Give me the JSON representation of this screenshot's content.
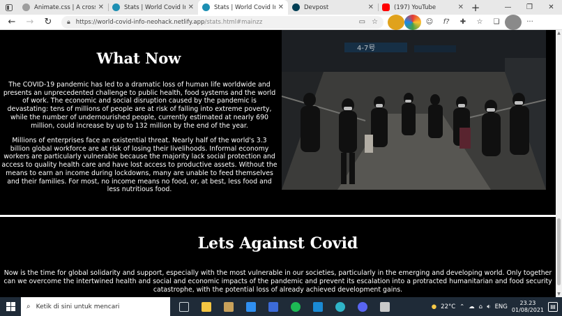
{
  "browser": {
    "tabs": [
      {
        "title": "Animate.css | A cross-brow",
        "fav_color": "#9e9e9e",
        "active": false
      },
      {
        "title": "Stats | World Covid Info",
        "fav_color": "#1d8fb3",
        "active": false
      },
      {
        "title": "Stats | World Covid Info",
        "fav_color": "#1d8fb3",
        "active": true
      },
      {
        "title": "Devpost",
        "fav_color": "#003e54",
        "active": false
      },
      {
        "title": "(197) YouTube",
        "fav_color": "#ff0000",
        "active": false
      }
    ],
    "url_host": "https://world-covid-info-neohack.netlify.app",
    "url_path": "/stats.html#mainzz"
  },
  "page": {
    "section1": {
      "heading": "What Now",
      "paragraph1": "The COVID-19 pandemic has led to a dramatic loss of human life worldwide and presents an unprecedented challenge to public health, food systems and the world of work. The economic and social disruption caused by the pandemic is devastating: tens of millions of people are at risk of falling into extreme poverty, while the number of undernourished people, currently estimated at nearly 690 million, could increase by up to 132 million by the end of the year.",
      "paragraph2": "Millions of enterprises face an existential threat. Nearly half of the world's 3.3 billion global workforce are at risk of losing their livelihoods. Informal economy workers are particularly vulnerable because the majority lack social protection and access to quality health care and have lost access to productive assets. Without the means to earn an income during lockdowns, many are unable to feed themselves and their families. For most, no income means no food, or, at best, less food and less nutritious food.",
      "photo_sign": "4-7号"
    },
    "section2": {
      "heading": "Lets Against Covid",
      "paragraph": "Now is the time for global solidarity and support, especially with the most vulnerable in our societies, particularly in the emerging and developing world. Only together can we overcome the intertwined health and social and economic impacts of the pandemic and prevent its escalation into a protracted humanitarian and food security catastrophe, with the potential loss of already achieved development gains."
    }
  },
  "taskbar": {
    "search_placeholder": "Ketik di sini untuk mencari",
    "apps": [
      {
        "name": "task-view",
        "color": "#cfd8dc"
      },
      {
        "name": "file-explorer",
        "color": "#f4c542"
      },
      {
        "name": "store",
        "color": "#c8a15a"
      },
      {
        "name": "mail",
        "color": "#2f8ff0"
      },
      {
        "name": "vscode-alt",
        "color": "#3c6bd8"
      },
      {
        "name": "spotify",
        "color": "#1db954"
      },
      {
        "name": "vscode",
        "color": "#1a8ad4"
      },
      {
        "name": "edge",
        "color": "#2fb4c8"
      },
      {
        "name": "discord",
        "color": "#5865f2"
      },
      {
        "name": "paint",
        "color": "#c9c9c9"
      }
    ],
    "weather": "22°C",
    "time": "23.23",
    "date": "01/08/2021"
  }
}
